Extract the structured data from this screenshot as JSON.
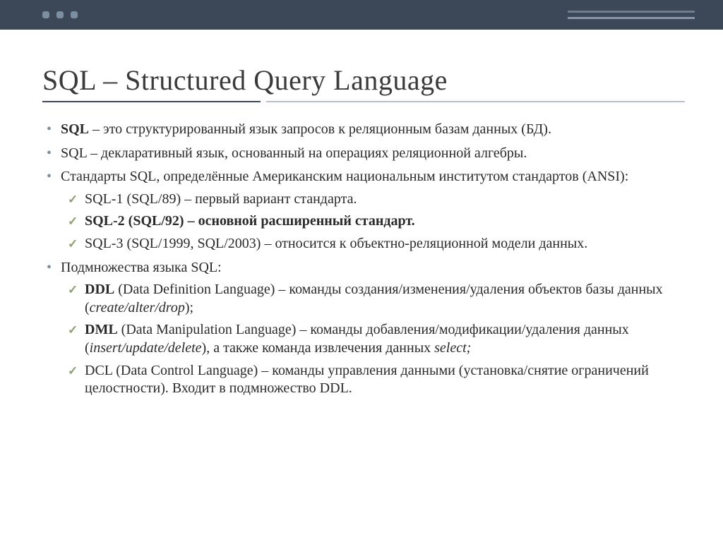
{
  "title": "SQL – Structured Query Language",
  "bullets": [
    {
      "html": "<b>SQL</b> – это структурированный язык запросов к реляционным базам данных (БД)."
    },
    {
      "html": "SQL – декларативный язык, основанный на операциях реляционной алгебры."
    },
    {
      "html": "Стандарты SQL, определённые Американским национальным институтом стандартов (ANSI):",
      "sub": [
        {
          "html": "SQL-1 (SQL/89) – первый вариант стандарта."
        },
        {
          "html": "<b>SQL-2 (SQL/92) – основной расширенный стандарт.</b>"
        },
        {
          "html": "SQL-3 (SQL/1999, SQL/2003) – относится к объектно-реляционной модели данных."
        }
      ]
    },
    {
      "html": "Подмножества языка SQL:",
      "sub": [
        {
          "html": "<b>DDL</b> (Data Definition Language) – команды создания/изменения/удаления объектов базы данных (<i>create/alter/drop</i>);"
        },
        {
          "html": "<b>DML</b> (Data Manipulation Language) – команды добавления/модификации/удаления данных (<i>insert/update/delete</i>), а также команда извлечения данных <i>select;</i>"
        },
        {
          "html": "DCL (Data Control Language) – команды управления данными (установка/снятие ограничений целостности). Входит в подмножество DDL."
        }
      ]
    }
  ]
}
